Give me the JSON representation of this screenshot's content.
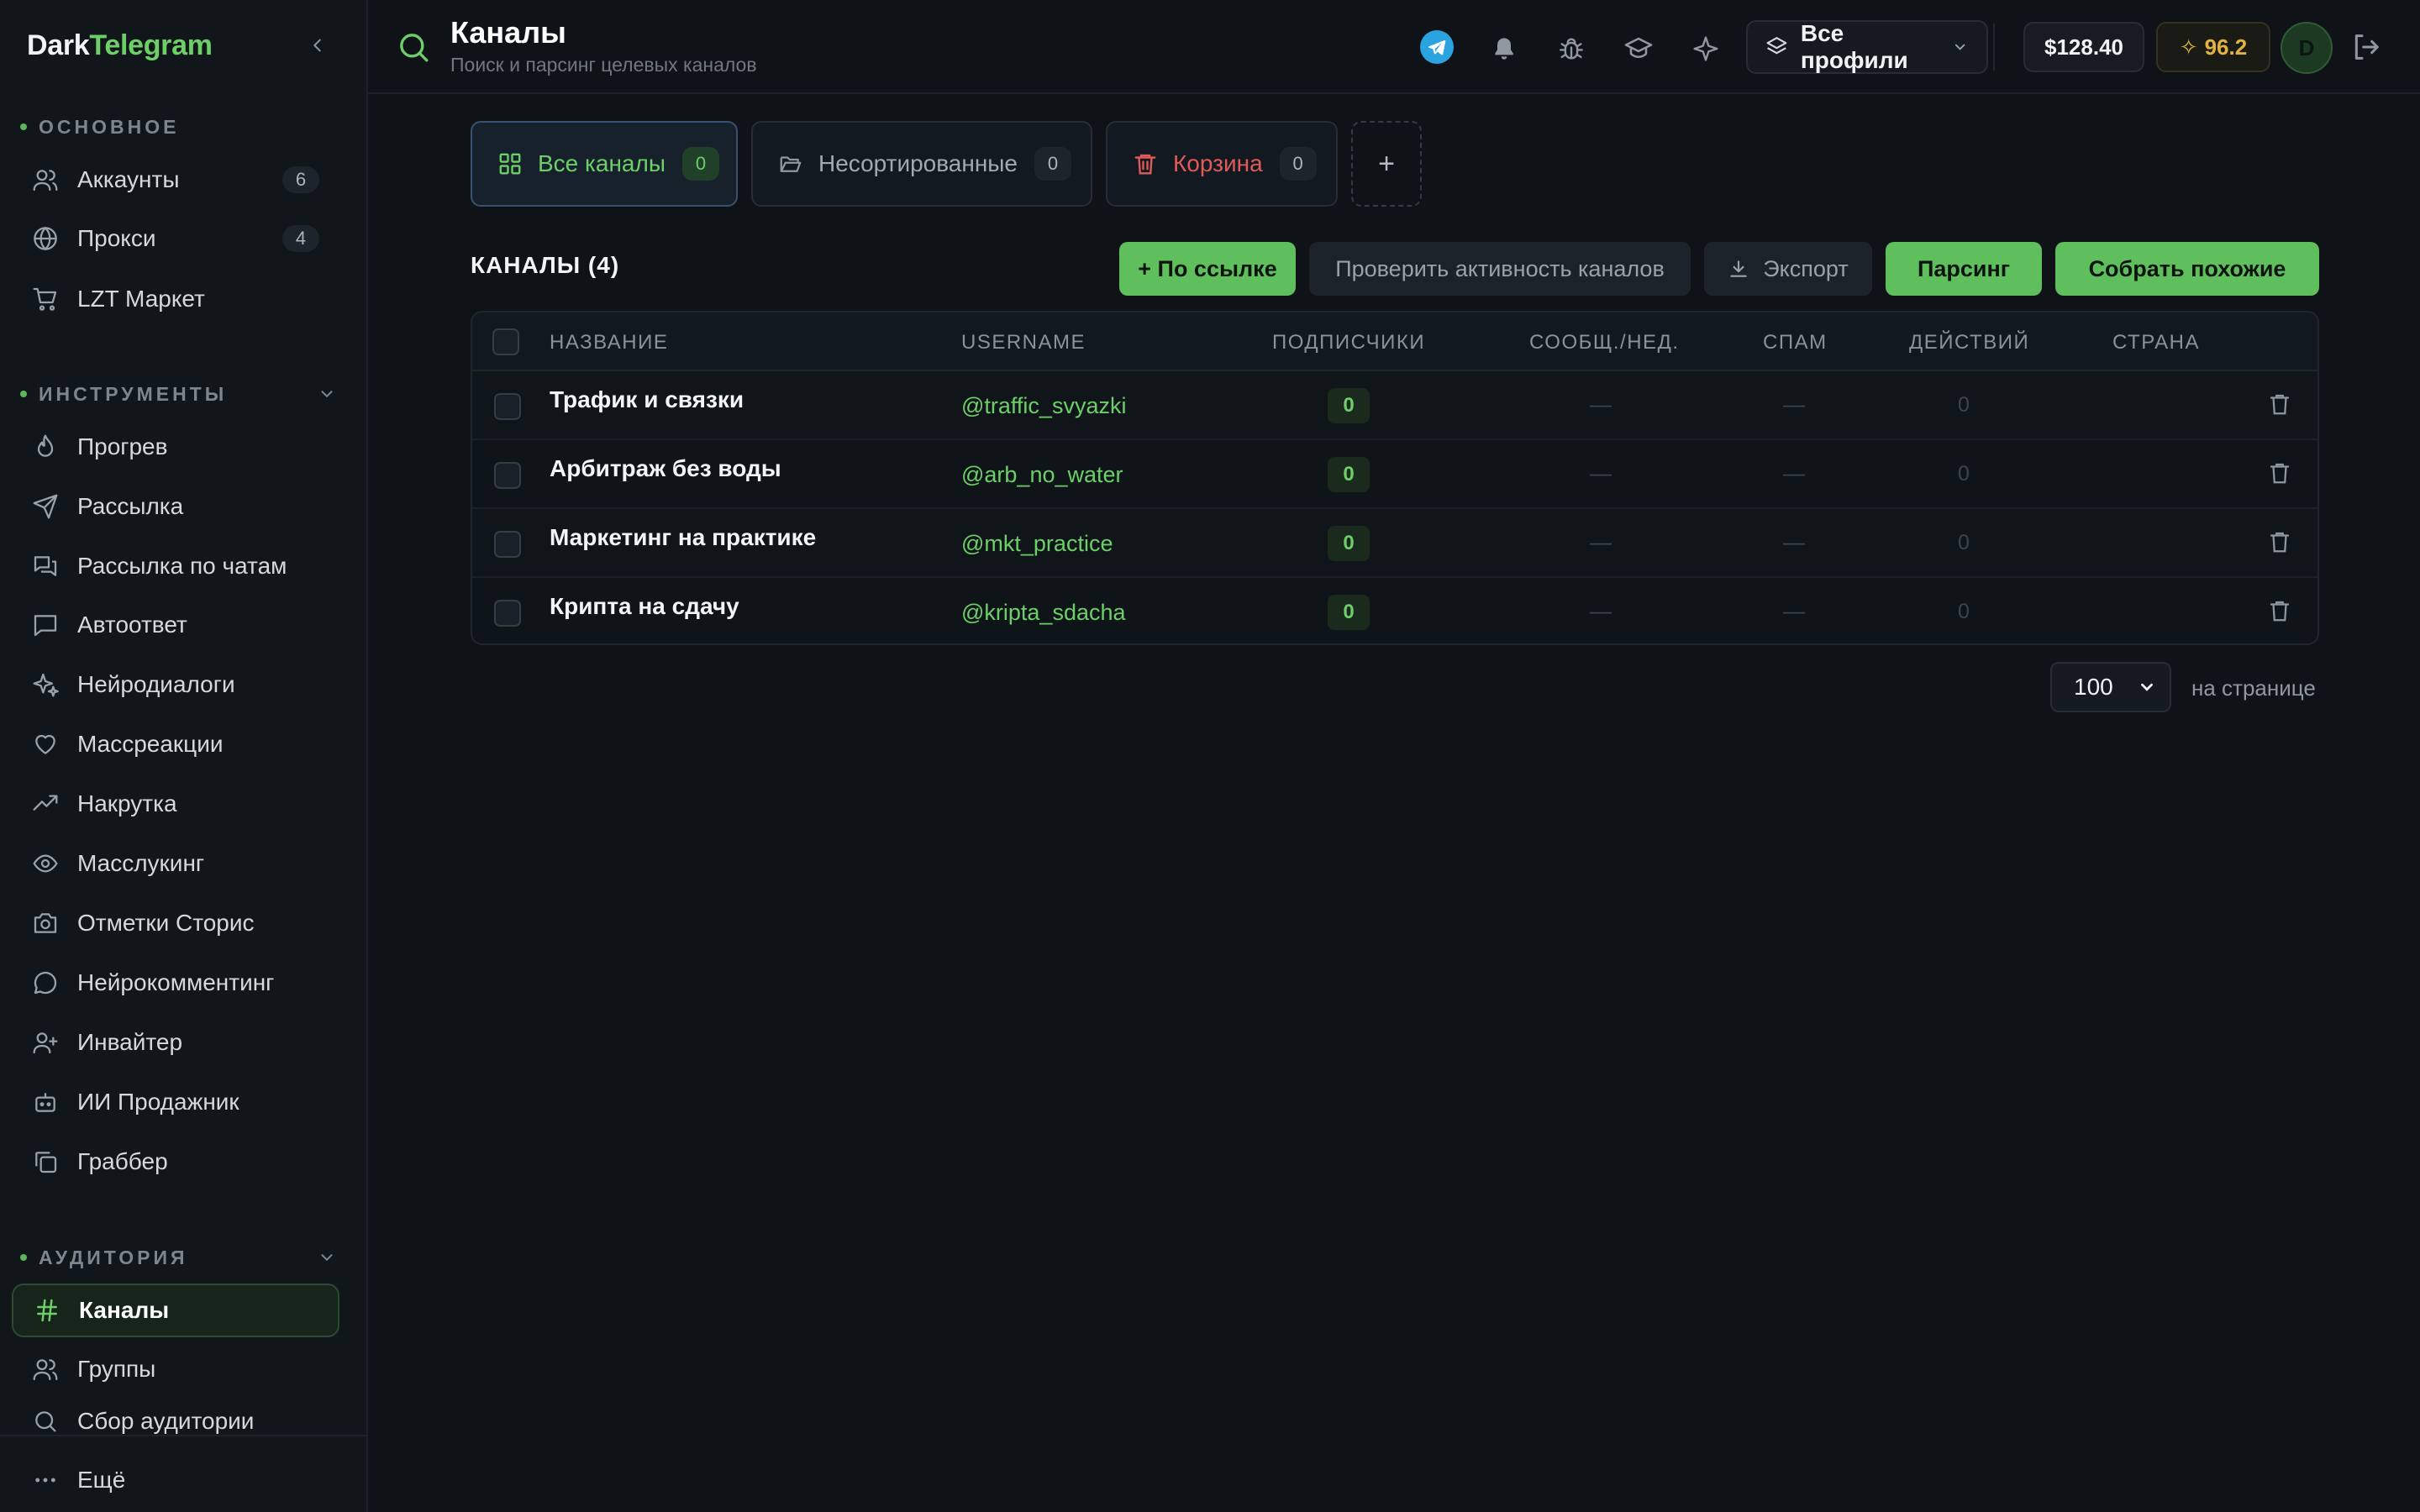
{
  "brand": {
    "part1": "Dark",
    "part2": "Telegram"
  },
  "sidebar": {
    "sections": {
      "main": "ОСНОВНОЕ",
      "tools": "ИНСТРУМЕНТЫ",
      "audience": "АУДИТОРИЯ"
    },
    "main_items": [
      {
        "label": "Аккаунты",
        "count": "6",
        "icon": "users-icon"
      },
      {
        "label": "Прокси",
        "count": "4",
        "icon": "globe-icon"
      },
      {
        "label": "LZT Маркет",
        "icon": "cart-icon"
      }
    ],
    "tool_items": [
      {
        "label": "Прогрев",
        "icon": "flame-icon"
      },
      {
        "label": "Рассылка",
        "icon": "send-icon"
      },
      {
        "label": "Рассылка по чатам",
        "icon": "chats-icon"
      },
      {
        "label": "Автоответ",
        "icon": "message-square-icon"
      },
      {
        "label": "Нейродиалоги",
        "icon": "sparkles-icon"
      },
      {
        "label": "Массреакции",
        "icon": "heart-icon"
      },
      {
        "label": "Накрутка",
        "icon": "trending-up-icon"
      },
      {
        "label": "Масслукинг",
        "icon": "eye-icon"
      },
      {
        "label": "Отметки Сторис",
        "icon": "camera-icon"
      },
      {
        "label": "Нейрокомментинг",
        "icon": "message-circle-icon"
      },
      {
        "label": "Инвайтер",
        "icon": "user-plus-icon"
      },
      {
        "label": "ИИ Продажник",
        "icon": "bot-icon"
      },
      {
        "label": "Граббер",
        "icon": "copy-icon"
      }
    ],
    "audience_items": [
      {
        "label": "Каналы",
        "icon": "hash-icon",
        "active": true
      },
      {
        "label": "Группы",
        "icon": "users-icon"
      },
      {
        "label": "Сбор аудитории",
        "icon": "search-icon"
      }
    ],
    "more_label": "Ещё"
  },
  "header": {
    "title": "Каналы",
    "subtitle": "Поиск и парсинг целевых каналов",
    "profile_select": "Все профили",
    "balance": "$128.40",
    "rating": "96.2",
    "avatar_letter": "D"
  },
  "folders": [
    {
      "label": "Все каналы",
      "count": "0",
      "active": true
    },
    {
      "label": "Несортированные",
      "count": "0"
    },
    {
      "label": "Корзина",
      "count": "0"
    }
  ],
  "toolbar": {
    "section_title": "КАНАЛЫ (4)",
    "add_by_link": "+ По ссылке",
    "check_activity": "Проверить активность каналов",
    "export": "Экспорт",
    "parsing": "Парсинг",
    "collect_similar": "Собрать похожие"
  },
  "table": {
    "columns": [
      "НАЗВАНИЕ",
      "USERNAME",
      "ПОДПИСЧИКИ",
      "СООБЩ./НЕД.",
      "СПАМ",
      "ДЕЙСТВИЙ",
      "СТРАНА"
    ],
    "rows": [
      {
        "name": "Трафик и связки",
        "username": "@traffic_svyazki",
        "subscribers": "0",
        "msgs": "—",
        "spam": "—",
        "actions": "0",
        "country": ""
      },
      {
        "name": "Арбитраж без воды",
        "username": "@arb_no_water",
        "subscribers": "0",
        "msgs": "—",
        "spam": "—",
        "actions": "0",
        "country": ""
      },
      {
        "name": "Маркетинг на практике",
        "username": "@mkt_practice",
        "subscribers": "0",
        "msgs": "—",
        "spam": "—",
        "actions": "0",
        "country": ""
      },
      {
        "name": "Крипта на сдачу",
        "username": "@kripta_sdacha",
        "subscribers": "0",
        "msgs": "—",
        "spam": "—",
        "actions": "0",
        "country": ""
      }
    ]
  },
  "pagination": {
    "per_page": "100",
    "per_page_label": "на странице"
  },
  "colors": {
    "accent": "#6ccf67",
    "danger": "#e05a5a",
    "gold": "#e3b341",
    "background": "#0f1318"
  }
}
